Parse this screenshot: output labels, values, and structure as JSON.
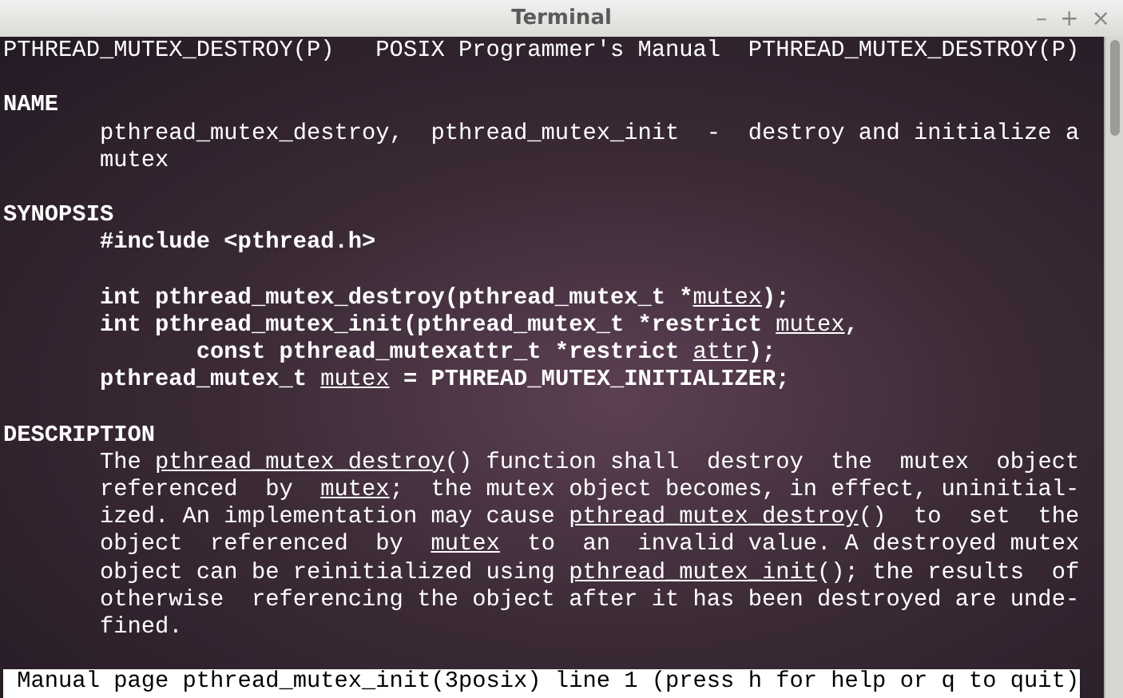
{
  "window": {
    "title": "Terminal",
    "controls": [
      "–",
      "+",
      "×"
    ]
  },
  "lines": [
    {
      "kind": "text",
      "segments": [
        {
          "text": "PTHREAD_MUTEX_DESTROY(P)   POSIX Programmer's Manual  PTHREAD_MUTEX_DESTROY(P)",
          "kind": "plain"
        }
      ]
    },
    {
      "kind": "blank"
    },
    {
      "kind": "text",
      "segments": [
        {
          "text": "NAME",
          "kind": "bold"
        }
      ]
    },
    {
      "kind": "text",
      "segments": [
        {
          "text": "       pthread_mutex_destroy,  pthread_mutex_init  -  destroy and initialize a",
          "kind": "plain"
        }
      ]
    },
    {
      "kind": "text",
      "segments": [
        {
          "text": "       mutex",
          "kind": "plain"
        }
      ]
    },
    {
      "kind": "blank"
    },
    {
      "kind": "text",
      "segments": [
        {
          "text": "SYNOPSIS",
          "kind": "bold"
        }
      ]
    },
    {
      "kind": "text",
      "segments": [
        {
          "text": "       #include <pthread.h>",
          "kind": "bold"
        }
      ]
    },
    {
      "kind": "blank"
    },
    {
      "kind": "text",
      "segments": [
        {
          "text": "       int pthread_mutex_destroy(pthread_mutex_t *",
          "kind": "bold"
        },
        {
          "text": "mutex",
          "kind": "underline"
        },
        {
          "text": ");",
          "kind": "bold"
        }
      ]
    },
    {
      "kind": "text",
      "segments": [
        {
          "text": "       int pthread_mutex_init(pthread_mutex_t *restrict ",
          "kind": "bold"
        },
        {
          "text": "mutex",
          "kind": "underline"
        },
        {
          "text": ",",
          "kind": "bold"
        }
      ]
    },
    {
      "kind": "text",
      "segments": [
        {
          "text": "              const pthread_mutexattr_t *restrict ",
          "kind": "bold"
        },
        {
          "text": "attr",
          "kind": "underline"
        },
        {
          "text": ");",
          "kind": "bold"
        }
      ]
    },
    {
      "kind": "text",
      "segments": [
        {
          "text": "       pthread_mutex_t ",
          "kind": "bold"
        },
        {
          "text": "mutex",
          "kind": "underline"
        },
        {
          "text": " = PTHREAD_MUTEX_INITIALIZER;",
          "kind": "bold"
        }
      ]
    },
    {
      "kind": "blank"
    },
    {
      "kind": "text",
      "segments": [
        {
          "text": "DESCRIPTION",
          "kind": "bold"
        }
      ]
    },
    {
      "kind": "text",
      "segments": [
        {
          "text": "       The ",
          "kind": "plain"
        },
        {
          "text": "pthread_mutex_destroy",
          "kind": "underline"
        },
        {
          "text": "() function shall  destroy  the  mutex  object",
          "kind": "plain"
        }
      ]
    },
    {
      "kind": "text",
      "segments": [
        {
          "text": "       referenced  by  ",
          "kind": "plain"
        },
        {
          "text": "mutex",
          "kind": "underline"
        },
        {
          "text": ";  the mutex object becomes, in effect, uninitial-",
          "kind": "plain"
        }
      ]
    },
    {
      "kind": "text",
      "segments": [
        {
          "text": "       ized. An implementation may cause ",
          "kind": "plain"
        },
        {
          "text": "pthread_mutex_destroy",
          "kind": "underline"
        },
        {
          "text": "()  to  set  the",
          "kind": "plain"
        }
      ]
    },
    {
      "kind": "text",
      "segments": [
        {
          "text": "       object  referenced  by  ",
          "kind": "plain"
        },
        {
          "text": "mutex",
          "kind": "underline"
        },
        {
          "text": "  to  an  invalid value. A destroyed mutex",
          "kind": "plain"
        }
      ]
    },
    {
      "kind": "text",
      "segments": [
        {
          "text": "       object can be reinitialized using ",
          "kind": "plain"
        },
        {
          "text": "pthread_mutex_init",
          "kind": "underline"
        },
        {
          "text": "(); the results  of",
          "kind": "plain"
        }
      ]
    },
    {
      "kind": "text",
      "segments": [
        {
          "text": "       otherwise  referencing the object after it has been destroyed are unde-",
          "kind": "plain"
        }
      ]
    },
    {
      "kind": "text",
      "segments": [
        {
          "text": "       fined.",
          "kind": "plain"
        }
      ]
    },
    {
      "kind": "blank"
    }
  ],
  "status_bar": {
    "text": " Manual page pthread_mutex_init(3posix) line 1 (press h for help or q to quit)"
  }
}
